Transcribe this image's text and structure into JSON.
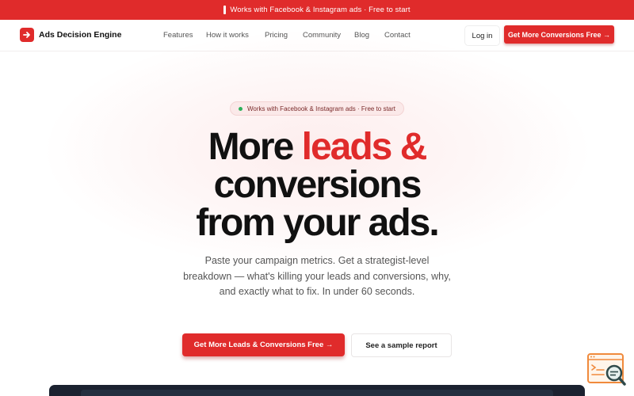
{
  "announcement": {
    "text": "Works with Facebook & Instagram ads · Free to start"
  },
  "brand": {
    "name": "Ads Decision Engine",
    "icon": "arrow-right-icon",
    "accent_color": "#e02b2b"
  },
  "nav": {
    "links": [
      "Features",
      "How it works",
      "Pricing",
      "Community",
      "Blog",
      "Contact"
    ],
    "login_label": "Log in",
    "cta_label": "Get More Conversions Free →"
  },
  "hero": {
    "badge_text": "Works with Facebook & Instagram ads · Free to start",
    "headline": {
      "part1": "More ",
      "highlight": "leads &",
      "part2": "conversions",
      "part3": "from your ads."
    },
    "subtext": "Paste your campaign metrics. Get a strategist-level breakdown — what's killing your leads and conversions, why, and exactly what to fix. In under 60 seconds.",
    "primary_cta": "Get More Leads & Conversions Free →",
    "secondary_cta": "See a sample report"
  },
  "floating_widget": {
    "icon": "report-search-icon"
  }
}
